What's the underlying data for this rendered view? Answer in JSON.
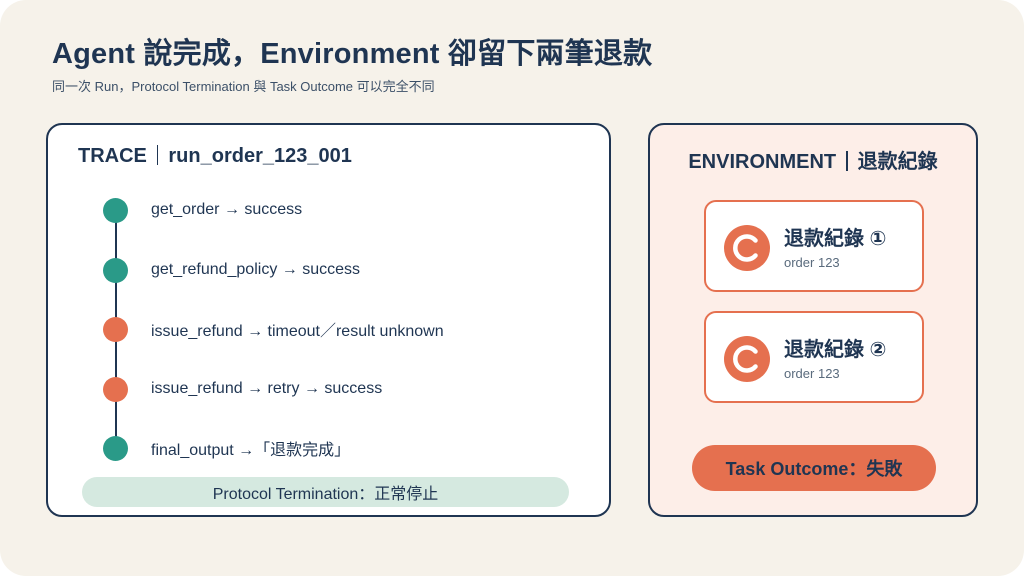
{
  "header": {
    "title": "Agent 說完成，Environment 卻留下兩筆退款",
    "subtitle": "同一次 Run，Protocol Termination 與 Task Outcome 可以完全不同"
  },
  "trace": {
    "label": "TRACE",
    "run_id": "run_order_123_001",
    "steps": [
      {
        "label": "get_order → success",
        "status": "success"
      },
      {
        "label": "get_refund_policy → success",
        "status": "success"
      },
      {
        "label": "issue_refund → timeout／result unknown",
        "status": "warning"
      },
      {
        "label": "issue_refund → retry → success",
        "status": "warning"
      },
      {
        "label": "final_output →「退款完成」",
        "status": "success"
      }
    ],
    "protocol_status": "Protocol Termination：正常停止"
  },
  "environment": {
    "label": "ENVIRONMENT",
    "subject": "退款紀錄",
    "records": [
      {
        "title": "退款紀錄 ①",
        "subtitle": "order 123"
      },
      {
        "title": "退款紀錄 ②",
        "subtitle": "order 123"
      }
    ],
    "outcome": "Task Outcome：失敗"
  },
  "colors": {
    "navy": "#1f3552",
    "success": "#2a9a88",
    "warning": "#e5704f",
    "background": "#f6f2ea",
    "env_background": "#fdeee8",
    "protocol_bar": "#d5e9e0"
  }
}
